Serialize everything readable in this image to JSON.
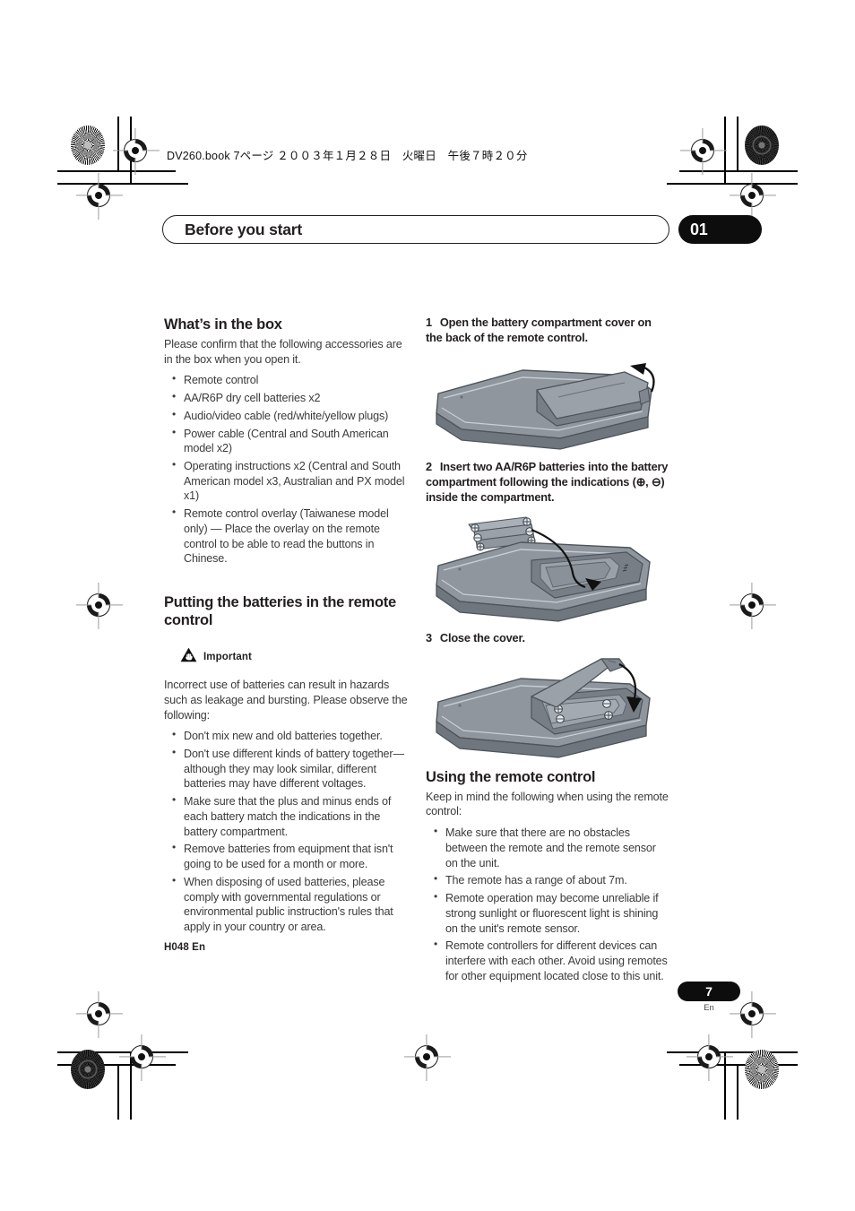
{
  "print_meta": {
    "book_line": "DV260.book  7ページ  ２００３年１月２８日　火曜日　午後７時２０分"
  },
  "header": {
    "chapter_title": "Before you start",
    "chapter_number": "01"
  },
  "left_column": {
    "section1": {
      "heading": "What’s in the box",
      "intro": "Please confirm that the following accessories are in the box when you open it.",
      "items": [
        "Remote control",
        "AA/R6P dry cell batteries x2",
        "Audio/video cable (red/white/yellow plugs)",
        "Power cable  (Central and South American model x2)",
        "Operating instructions x2  (Central and South American model x3, Australian and PX model x1)",
        "Remote control overlay (Taiwanese model only) — Place the overlay on the remote control to be able to read the buttons in Chinese."
      ]
    },
    "section2": {
      "heading": "Putting the batteries in the remote control",
      "important_label": "Important",
      "important_icon": "warning-triangle-hand-icon",
      "intro": "Incorrect use of batteries can result in hazards such as leakage and bursting. Please observe the following:",
      "items": [
        "Don't mix new and old batteries together.",
        "Don't use different kinds of battery together—although they may look similar, different batteries may have different voltages.",
        "Make sure that the plus and minus ends of each battery match the indications in the battery compartment.",
        "Remove batteries from equipment that isn't going to be used for a month or more.",
        "When disposing of used batteries, please comply with governmental regulations or environmental public instruction's rules that apply in your country or area."
      ],
      "code_note": "H048 En"
    }
  },
  "right_column": {
    "steps": [
      {
        "num": "1",
        "text": "Open the battery compartment cover on the back of the remote control.",
        "figure": "remote-open-cover-illustration"
      },
      {
        "num": "2",
        "text": "Insert two AA/R6P batteries into the battery compartment following the indications (⊕, ⊖) inside the compartment.",
        "figure": "remote-insert-batteries-illustration"
      },
      {
        "num": "3",
        "text": "Close the cover.",
        "figure": "remote-close-cover-illustration"
      }
    ],
    "section3": {
      "heading": "Using the remote control",
      "intro": "Keep in mind the following when using the remote control:",
      "items": [
        "Make sure that there are no obstacles between the remote and the remote sensor on the unit.",
        "The remote has a range of about 7m.",
        "Remote operation may become unreliable if strong sunlight or fluorescent light is shining on the unit's remote sensor.",
        "Remote controllers for different devices can interfere with each other. Avoid using remotes for other equipment located close to this unit."
      ]
    }
  },
  "footer": {
    "page_number": "7",
    "language": "En"
  },
  "colors": {
    "ink": "#231f20",
    "body_text": "#3b3b3d",
    "badge_black": "#0d0d0d",
    "remote_gray": "#8f969e",
    "remote_dark": "#6f767e"
  }
}
